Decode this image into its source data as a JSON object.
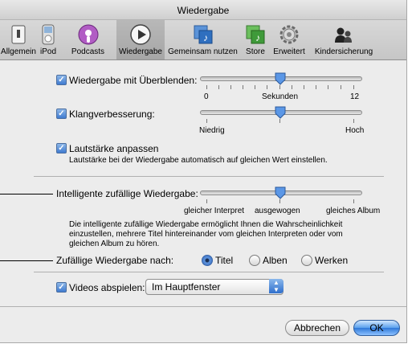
{
  "window": {
    "title": "Wiedergabe"
  },
  "toolbar": {
    "items": [
      {
        "label": "Allgemein",
        "icon": "switch-icon"
      },
      {
        "label": "iPod",
        "icon": "ipod-icon"
      },
      {
        "label": "Podcasts",
        "icon": "podcast-icon"
      },
      {
        "label": "Wiedergabe",
        "icon": "play-icon",
        "selected": true
      },
      {
        "label": "Gemeinsam nutzen",
        "icon": "shared-music-icon"
      },
      {
        "label": "Store",
        "icon": "store-icon"
      },
      {
        "label": "Erweitert",
        "icon": "gear-icon"
      },
      {
        "label": "Kindersicherung",
        "icon": "parental-icon"
      }
    ]
  },
  "crossfade": {
    "label": "Wiedergabe mit Überblenden:",
    "checked": true,
    "min_label": "0",
    "mid_label": "Sekunden",
    "max_label": "12",
    "value_seconds": 6
  },
  "sound_enhancer": {
    "label": "Klangverbesserung:",
    "checked": true,
    "min_label": "Niedrig",
    "max_label": "Hoch",
    "level": 0.5
  },
  "sound_check": {
    "label": "Lautstärke anpassen",
    "checked": true,
    "description": "Lautstärke bei der Wiedergabe automatisch auf gleichen Wert einstellen."
  },
  "smart_shuffle": {
    "label": "Intelligente zufällige Wiedergabe:",
    "left_label": "gleicher Interpret",
    "mid_label": "ausgewogen",
    "right_label": "gleiches Album",
    "level": 0.5,
    "description_lines": [
      "Die intelligente zufällige Wiedergabe ermöglicht Ihnen die Wahrscheinlichkeit",
      "einzustellen, mehrere Titel hintereinander vom gleichen Interpreten oder vom",
      "gleichen Album zu hören."
    ]
  },
  "shuffle_by": {
    "label": "Zufällige Wiedergabe nach:",
    "options": [
      {
        "label": "Titel",
        "selected": true
      },
      {
        "label": "Alben",
        "selected": false
      },
      {
        "label": "Werken",
        "selected": false
      }
    ]
  },
  "videos": {
    "label": "Videos abspielen:",
    "checked": true,
    "selected": "Im Hauptfenster"
  },
  "buttons": {
    "cancel": "Abbrechen",
    "ok": "OK"
  },
  "colors": {
    "accent": "#3f7bd0",
    "window_bg": "#ececec"
  }
}
